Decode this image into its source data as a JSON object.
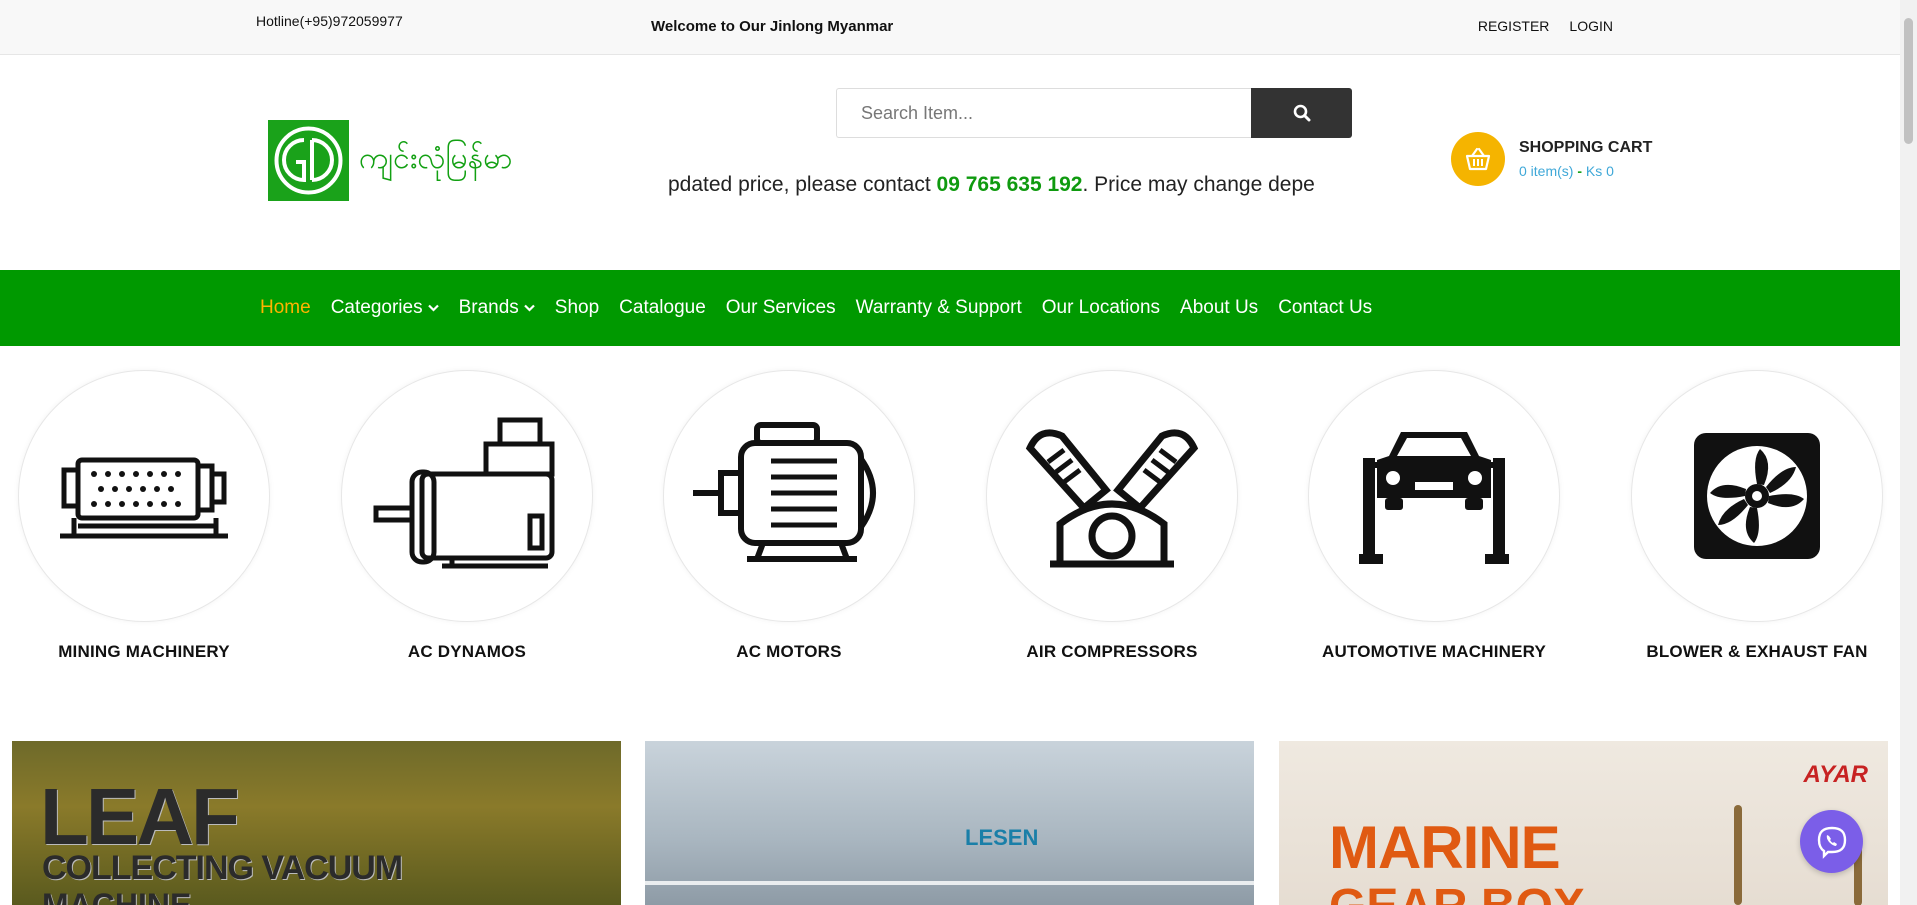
{
  "topbar": {
    "hotline": "Hotline(+95)972059977",
    "welcome": "Welcome to Our Jinlong Myanmar",
    "register": "REGISTER",
    "login": "LOGIN"
  },
  "header": {
    "logo_text": "ကျင်းလုံမြန်မာ",
    "search_placeholder": "Search Item...",
    "marquee_before": "pdated price, please contact ",
    "marquee_phone": "09 765 635 192",
    "marquee_after": ".  Price may change depe",
    "cart_title": "SHOPPING CART",
    "cart_items": "0 item(s)",
    "cart_sep": "-",
    "cart_total": "Ks 0"
  },
  "nav": {
    "items": [
      {
        "label": "Home"
      },
      {
        "label": "Categories"
      },
      {
        "label": "Brands"
      },
      {
        "label": "Shop"
      },
      {
        "label": "Catalogue"
      },
      {
        "label": "Our Services"
      },
      {
        "label": "Warranty & Support"
      },
      {
        "label": "Our Locations"
      },
      {
        "label": "About Us"
      },
      {
        "label": "Contact Us"
      }
    ]
  },
  "categories": [
    {
      "label": "MINING MACHINERY",
      "icon": "mining-machine-icon"
    },
    {
      "label": "AC DYNAMOS",
      "icon": "dynamo-icon"
    },
    {
      "label": "AC MOTORS",
      "icon": "motor-icon"
    },
    {
      "label": "AIR COMPRESSORS",
      "icon": "compressor-icon"
    },
    {
      "label": "AUTOMOTIVE MACHINERY",
      "icon": "car-lift-icon"
    },
    {
      "label": "BLOWER & EXHAUST FAN",
      "icon": "fan-icon"
    }
  ],
  "banners": {
    "b1_line1": "LEAF",
    "b1_line2": "COLLECTING VACUUM",
    "b1_line3": "MACHINE",
    "b2_brand": "LESEN",
    "b3_line1": "MARINE",
    "b3_line2": "GEAR BOX",
    "b3_brand": "AYAR"
  },
  "colors": {
    "nav_green": "#009900",
    "active_orange": "#ffb400",
    "cart_yellow": "#f5b400",
    "viber_purple": "#7b5ee8"
  }
}
